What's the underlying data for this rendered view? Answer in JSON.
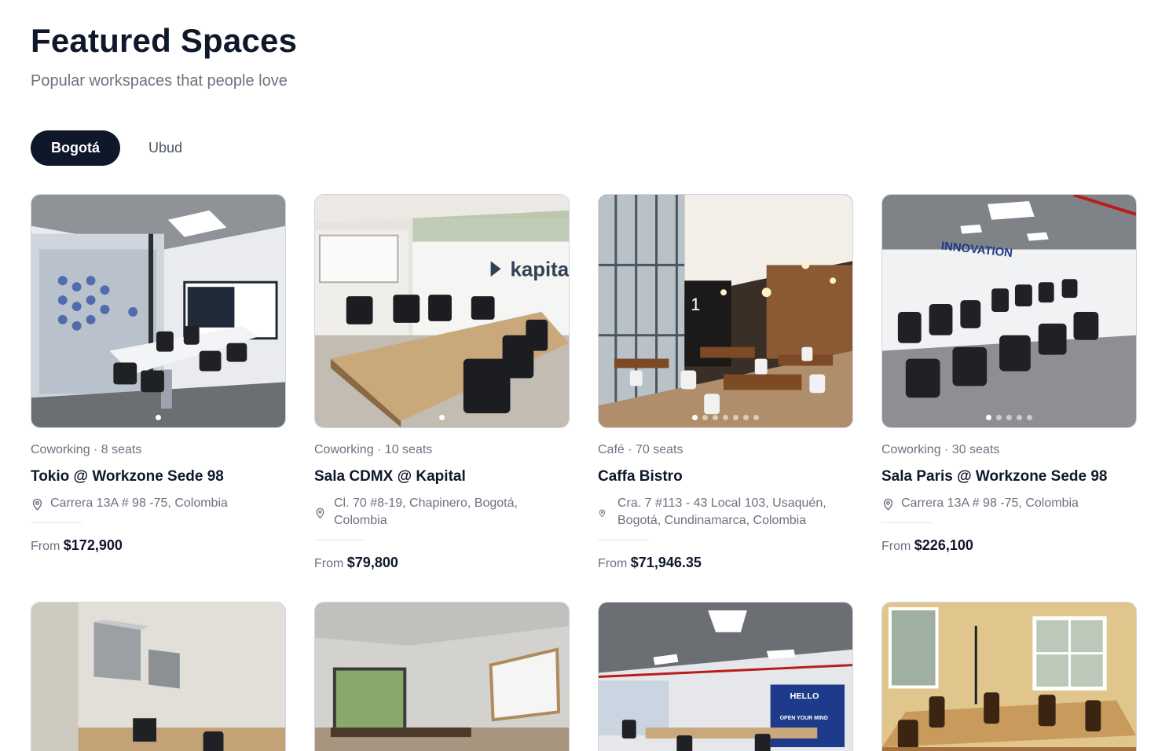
{
  "header": {
    "title": "Featured Spaces",
    "subtitle": "Popular workspaces that people love"
  },
  "tabs": [
    {
      "label": "Bogotá",
      "active": true
    },
    {
      "label": "Ubud",
      "active": false
    }
  ],
  "cards": [
    {
      "meta": "Coworking · 8 seats",
      "name": "Tokio @ Workzone Sede 98",
      "address": "Carrera 13A # 98 -75, Colombia",
      "price_prefix": "From",
      "price": "$172,900",
      "photo_dots": 1,
      "active_dot": 0
    },
    {
      "meta": "Coworking · 10 seats",
      "name": "Sala CDMX @ Kapital",
      "address": "Cl. 70 #8-19, Chapinero, Bogotá, Colombia",
      "price_prefix": "From",
      "price": "$79,800",
      "photo_dots": 1,
      "active_dot": 0
    },
    {
      "meta": "Café · 70 seats",
      "name": "Caffa Bistro",
      "address": "Cra. 7 #113 - 43 Local 103, Usaquén, Bogotá, Cundinamarca, Colombia",
      "price_prefix": "From",
      "price": "$71,946.35",
      "photo_dots": 7,
      "active_dot": 0
    },
    {
      "meta": "Coworking · 30 seats",
      "name": "Sala Paris @ Workzone Sede 98",
      "address": "Carrera 13A # 98 -75, Colombia",
      "price_prefix": "From",
      "price": "$226,100",
      "photo_dots": 5,
      "active_dot": 0
    }
  ],
  "photo_text": {
    "kapital_sign": "kapita",
    "innovation_sign": "INNOVATION",
    "hello_sign": "HELLO",
    "open_sign": "OPEN YOUR MIND"
  },
  "colors": {
    "active_tab_bg": "#0f172a",
    "text_primary": "#0f172a",
    "text_muted": "#6b7280"
  },
  "icons": {
    "location": "map-pin-icon"
  }
}
